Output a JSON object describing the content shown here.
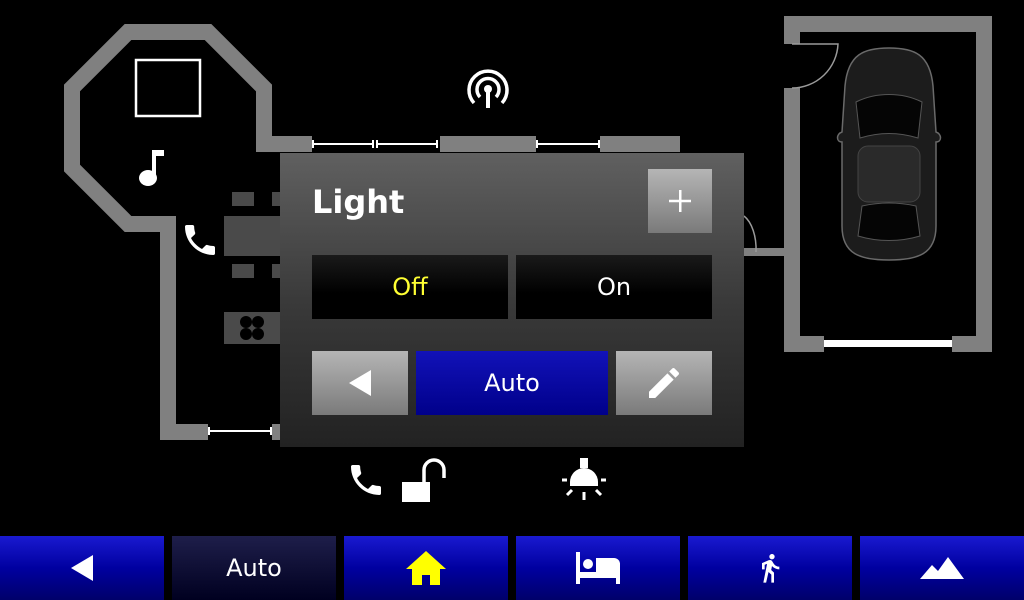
{
  "popup": {
    "title": "Light",
    "off_label": "Off",
    "on_label": "On",
    "mode_label": "Auto"
  },
  "nav": {
    "mode_label": "Auto"
  },
  "icons": {
    "antenna": "antenna-icon",
    "music": "music-note-icon",
    "phone": "phone-icon",
    "fan": "fan-icon",
    "unlock": "unlock-icon",
    "lamp": "ceiling-light-icon",
    "plus": "plus-icon",
    "back": "triangle-left-icon",
    "edit": "pencil-icon",
    "home": "home-icon",
    "bed": "bed-icon",
    "walk": "walking-person-icon",
    "mountain": "mountain-icon"
  },
  "colors": {
    "off_active": "#ffff33",
    "nav_blue": "#0000a0",
    "home_icon": "#ffff00",
    "wall": "#808080"
  }
}
